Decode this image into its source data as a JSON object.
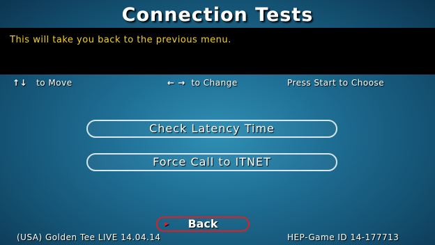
{
  "screen": {
    "title": "Connection Tests",
    "help_text": "This will take you back to the previous menu."
  },
  "controls": {
    "move_glyph": "↑↓",
    "move_label": "to Move",
    "change_glyph": "← →",
    "change_label": "to Change",
    "choose_label": "Press Start to Choose"
  },
  "menu": {
    "items": [
      {
        "label": "Check Latency Time"
      },
      {
        "label": "Force Call to ITNET"
      }
    ],
    "back_label": "Back",
    "selected": "Back"
  },
  "footer": {
    "version": "(USA) Golden Tee LIVE 14.04.14",
    "game_id": "HEP-Game ID 14-177713"
  },
  "colors": {
    "help_text": "#f4d21c",
    "selection_highlight": "#e02020",
    "button_border": "#d9e6ee"
  }
}
